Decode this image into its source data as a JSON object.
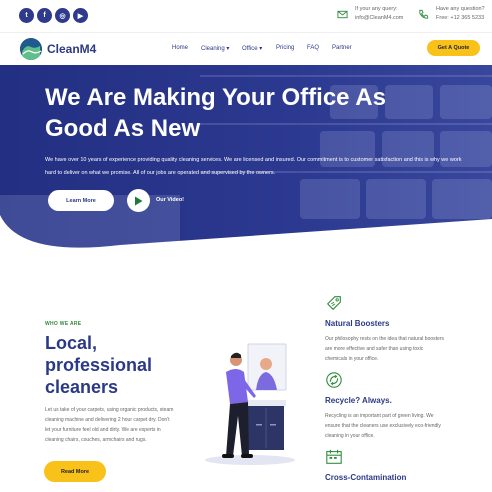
{
  "topbar": {
    "social": [
      {
        "icon": "twitter-icon",
        "glyph": "t"
      },
      {
        "icon": "facebook-icon",
        "glyph": "f"
      },
      {
        "icon": "instagram-icon",
        "glyph": "◎"
      },
      {
        "icon": "youtube-icon",
        "glyph": "▶"
      }
    ],
    "email": {
      "label": "If your any query:",
      "value": "info@CleanM4.com"
    },
    "phone": {
      "label": "Have any question?",
      "value": "Free: +12 365 5233"
    }
  },
  "nav": {
    "brand": "CleanM4",
    "items": [
      "Home",
      "Cleaning",
      "Office",
      "Pricing",
      "FAQ",
      "Partner"
    ],
    "dropdown_marker": "▾",
    "cta": "Get A Quote"
  },
  "hero": {
    "title": "We Are Making Your Office As Good As New",
    "text": "We have over 10 years of experience providing quality cleaning services. We are licensed and insured. Our commitment is to customer satisfaction and this is why we work hard to deliver on what we promise. All of our jobs are operated and supervised by the owners.",
    "learn_more": "Learn More",
    "video_label": "Our Video!"
  },
  "about": {
    "kicker": "WHO WE ARE",
    "title": "Local, professional cleaners",
    "text": "Let us take of your carpets, using organic products, steam cleaning machine and delivering 2 hour carpet dry. Don't let your furniture feel old and dirty. We are experts in cleaning chairs, couches, armchairs and rugs.",
    "read_more": "Read More"
  },
  "features": [
    {
      "icon": "tag-icon",
      "title": "Natural Boosters",
      "text": "Our philosophy rests on the idea that natural boosters are more effective and safer than using toxic chemicals in your office."
    },
    {
      "icon": "recycle-icon",
      "title": "Recycle? Always.",
      "text": "Recycling is an important part of green living. We ensure that the cleaners use exclusively eco-friendly cleaning in your office."
    },
    {
      "icon": "calendar-icon",
      "title": "Cross-Contamination",
      "text": ""
    }
  ],
  "colors": {
    "primary": "#2b3a86",
    "accent": "#f9c21b",
    "green": "#2e8b3c"
  }
}
